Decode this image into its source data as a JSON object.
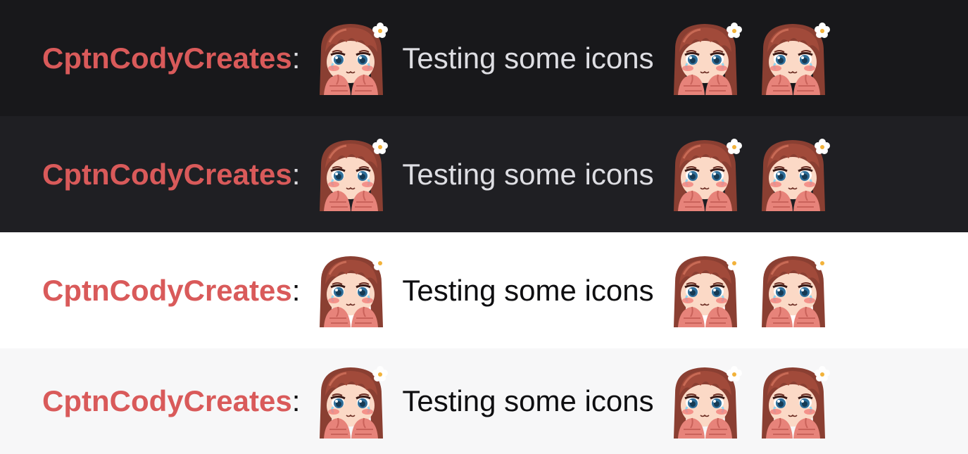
{
  "colors": {
    "username": "#d95a5a",
    "dark_text": "#dedee3",
    "light_text": "#0e0e10",
    "dark_bg_1": "#18181b",
    "dark_bg_2": "#1f1f23",
    "light_bg_1": "#ffffff",
    "light_bg_2": "#f7f7f8"
  },
  "rows": [
    {
      "theme": "dark",
      "username": "CptnCodyCreates",
      "separator": ":",
      "message": "Testing some icons",
      "emotes": [
        "crying-girl-emote",
        "crying-girl-emote",
        "crying-girl-emote"
      ]
    },
    {
      "theme": "dark",
      "username": "CptnCodyCreates",
      "separator": ":",
      "message": "Testing some icons",
      "emotes": [
        "crying-girl-emote",
        "crying-girl-emote",
        "crying-girl-emote"
      ]
    },
    {
      "theme": "light",
      "username": "CptnCodyCreates",
      "separator": ":",
      "message": "Testing some icons",
      "emotes": [
        "crying-girl-emote",
        "crying-girl-emote",
        "crying-girl-emote"
      ]
    },
    {
      "theme": "light",
      "username": "CptnCodyCreates",
      "separator": ":",
      "message": "Testing some icons",
      "emotes": [
        "crying-girl-emote",
        "crying-girl-emote",
        "crying-girl-emote"
      ]
    }
  ]
}
